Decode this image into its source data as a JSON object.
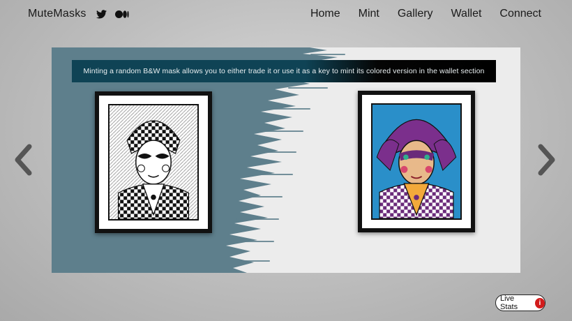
{
  "header": {
    "brand": "MuteMasks",
    "social": [
      {
        "icon": "twitter-icon"
      },
      {
        "icon": "medium-icon"
      }
    ],
    "nav": [
      {
        "label": "Home"
      },
      {
        "label": "Mint"
      },
      {
        "label": "Gallery"
      },
      {
        "label": "Wallet"
      },
      {
        "label": "Connect"
      }
    ]
  },
  "slide": {
    "caption": "Minting a random B&W mask allows you to either trade it or use it as a key to mint its colored version in the wallet section",
    "left_image": "black-and-white-jester-mask-artwork",
    "right_image": "colored-jester-mask-artwork"
  },
  "carousel": {
    "prev_icon": "chevron-left-icon",
    "next_icon": "chevron-right-icon"
  },
  "live_stats": {
    "label": "Live Stats",
    "badge_icon": "info-icon",
    "badge_glyph": "i"
  },
  "colors": {
    "slate": "#5e7f8c",
    "banner": "#0f4355",
    "purple": "#6a2a7a",
    "badge": "#d21b1b"
  }
}
